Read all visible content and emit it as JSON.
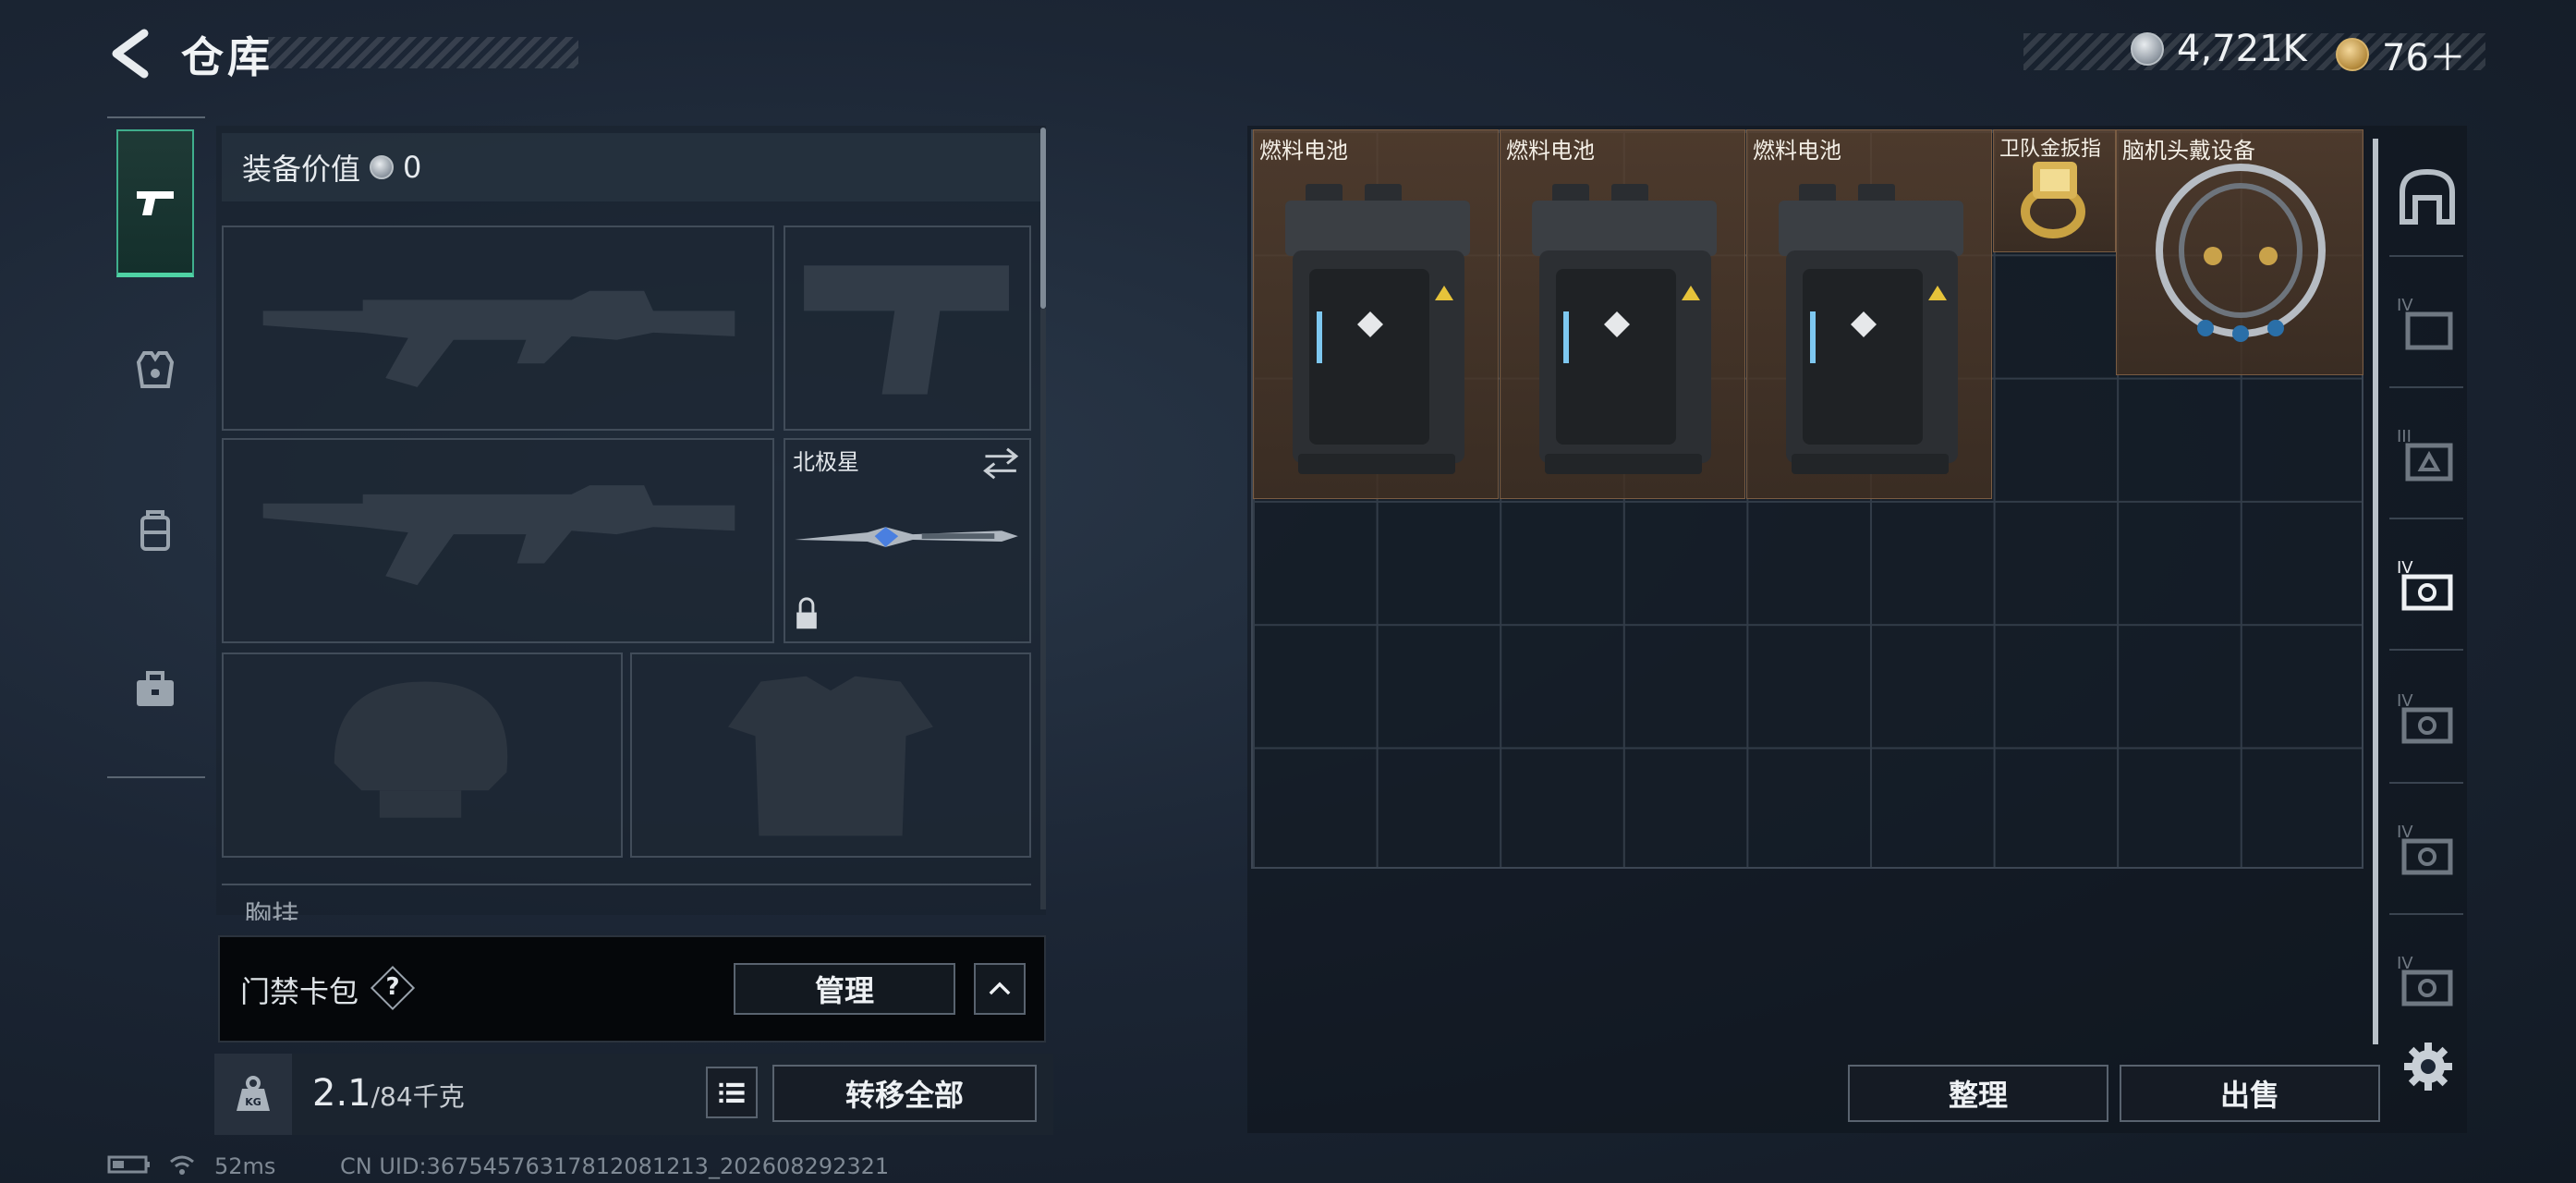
{
  "header": {
    "title": "仓库"
  },
  "currency": {
    "silver_amount": "4,721K",
    "gold_amount": "76＋"
  },
  "left_tabs": [
    {
      "icon": "pistol-icon",
      "active": true
    },
    {
      "icon": "armor-vest-icon",
      "active": false
    },
    {
      "icon": "backpack-icon",
      "active": false
    },
    {
      "icon": "toolbox-icon",
      "active": false
    }
  ],
  "equipment": {
    "value_label": "装备价值",
    "value_amount": "0",
    "melee_name": "北极星",
    "chest_label": "胸挂"
  },
  "access_card": {
    "label": "门禁卡包",
    "help": "?",
    "manage_label": "管理"
  },
  "capacity": {
    "current": "2.1",
    "max": "/84千克",
    "transfer_all_label": "转移全部"
  },
  "stash": {
    "items": [
      {
        "name": "燃料电池",
        "type": "fuel-cell"
      },
      {
        "name": "燃料电池",
        "type": "fuel-cell"
      },
      {
        "name": "燃料电池",
        "type": "fuel-cell"
      },
      {
        "name": "卫队金扳指",
        "type": "gold-ring"
      },
      {
        "name": "脑机头戴设备",
        "type": "headset"
      }
    ],
    "sort_label": "整理",
    "sell_label": "出售"
  },
  "status": {
    "ping": "52ms",
    "uid": "CN UID:3675457631781208121​3_202608292321"
  }
}
